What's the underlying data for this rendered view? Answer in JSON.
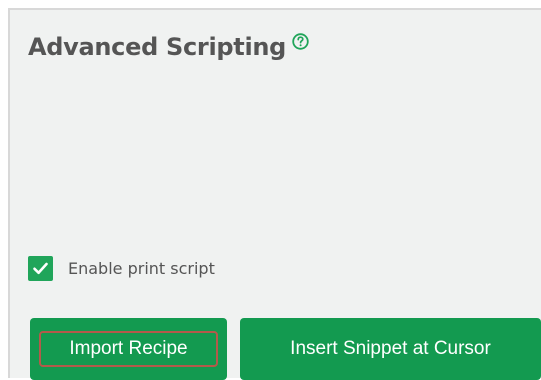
{
  "panel": {
    "title": "Advanced Scripting",
    "help_icon": "question-circle-icon",
    "checkbox": {
      "label": "Enable print script",
      "checked": true
    },
    "buttons": {
      "import_label": "Import Recipe",
      "insert_label": "Insert Snippet at Cursor"
    }
  },
  "colors": {
    "accent_green": "#139a50",
    "checkbox_green": "#20a55a",
    "focus_ring": "#b35a4a",
    "panel_bg": "#f0f2f1",
    "text": "#555555"
  }
}
